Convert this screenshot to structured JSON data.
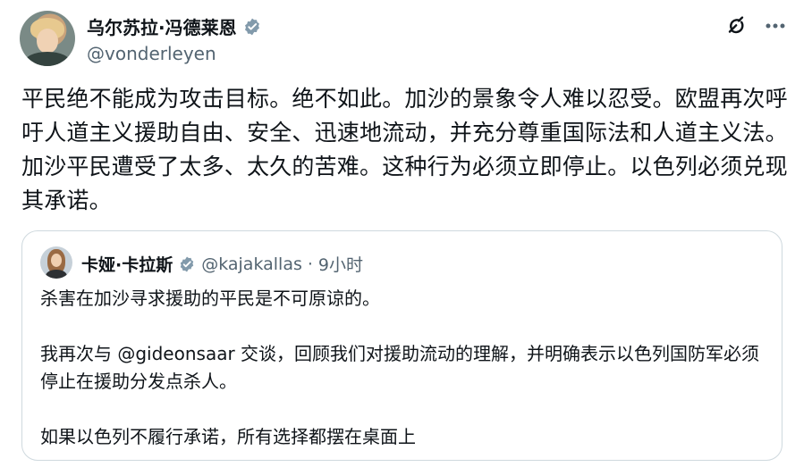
{
  "post": {
    "author_name": "乌尔苏拉·冯德莱恩",
    "author_handle": "@vonderleyen",
    "text": "平民绝不能成为攻击目标。绝不如此。加沙的景象令人难以忍受。欧盟再次呼吁人道主义援助自由、安全、迅速地流动，并充分尊重国际法和人道主义法。加沙平民遭受了太多、太久的苦难。这种行为必须立即停止。以色列必须兑现其承诺。"
  },
  "quoted_post": {
    "author_name": "卡娅·卡拉斯",
    "author_handle": "@kajakallas",
    "separator": "·",
    "time": "9小时",
    "paragraphs": [
      "杀害在加沙寻求援助的平民是不可原谅的。",
      "我再次与 @gideonsaar 交谈，回顾我们对援助流动的理解，并明确表示以色列国防军必须停止在援助分发点杀人。",
      "如果以色列不履行承诺，所有选择都摆在桌面上"
    ]
  },
  "icons": {
    "verified": "verified-badge-icon",
    "grok": "grok-icon",
    "more": "more-options-icon"
  },
  "colors": {
    "text_primary": "#0f1419",
    "text_secondary": "#536471",
    "verified_badge": "#829aab",
    "border": "#cfd9de"
  }
}
